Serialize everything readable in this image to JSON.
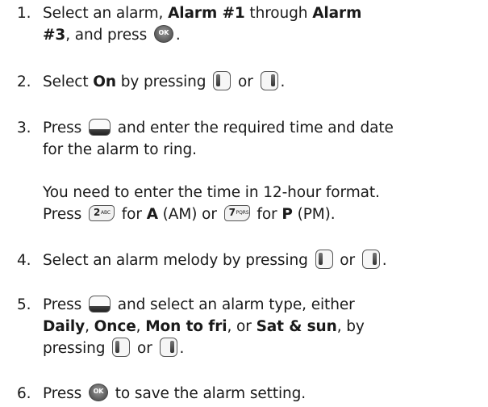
{
  "steps": [
    {
      "num": "1.",
      "p1": "Select an alarm, ",
      "b1": "Alarm #1",
      "p2": " through ",
      "b2": "Alarm",
      "l2b": "#3",
      "l2p": ", and press ",
      "l2end": "."
    },
    {
      "num": "2.",
      "p1": "Select ",
      "b1": "On",
      "p2": " by pressing ",
      "mid": " or ",
      "end": "."
    },
    {
      "num": "3.",
      "p1": "Press ",
      "p2": " and enter the required time and date",
      "l2": "for the alarm to ring."
    },
    {
      "para1": "You need to enter the time in 12-hour format.",
      "p1": "Press ",
      "p2": " for ",
      "b1": "A",
      "p3": " (AM) or ",
      "p4": " for ",
      "b2": "P",
      "p5": " (PM).",
      "key_a_digit": "2",
      "key_a_letters": "ABC",
      "key_p_digit": "7",
      "key_p_letters": "PQRS"
    },
    {
      "num": "4.",
      "p1": "Select an alarm melody by pressing ",
      "mid": " or ",
      "end": "."
    },
    {
      "num": "5.",
      "p1": "Press ",
      "p2": " and select an alarm type, either",
      "b1": "Daily",
      "c1": ", ",
      "b2": "Once",
      "c2": ", ",
      "b3": "Mon to fri",
      "c3": ", or ",
      "b4": "Sat & sun",
      "c4": ", by",
      "l3a": "pressing ",
      "mid": " or ",
      "end": "."
    },
    {
      "num": "6.",
      "p1": "Press ",
      "p2": " to save the alarm setting."
    }
  ],
  "icons": {
    "ok_label": "OK"
  }
}
